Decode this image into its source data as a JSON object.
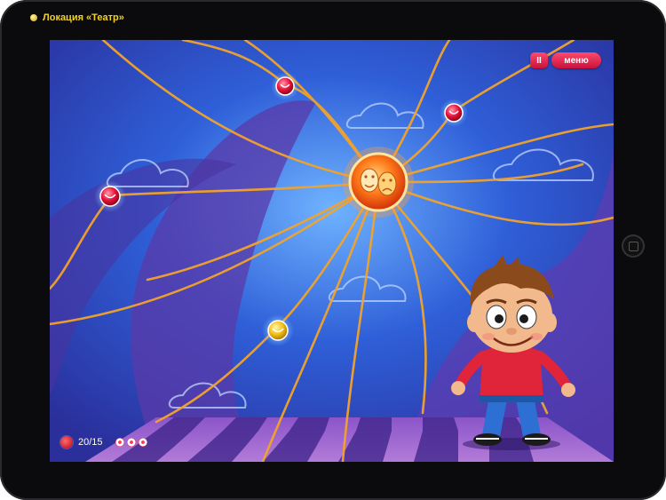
{
  "caption": {
    "text": "Локация «Театр»"
  },
  "top_controls": {
    "pause_label": "II",
    "menu_label": "меню"
  },
  "hud": {
    "progress_text": "20/15",
    "flowers_count": 3
  },
  "colors": {
    "accent": "#e8143c",
    "rope": "#f3a32a",
    "caption": "#f0d22a"
  },
  "nodes": [
    {
      "name": "node-top",
      "kind": "red"
    },
    {
      "name": "node-top-right",
      "kind": "red"
    },
    {
      "name": "node-left",
      "kind": "red"
    },
    {
      "name": "node-bottom",
      "kind": "yellow"
    },
    {
      "name": "center-theater-hub",
      "kind": "hub"
    }
  ]
}
